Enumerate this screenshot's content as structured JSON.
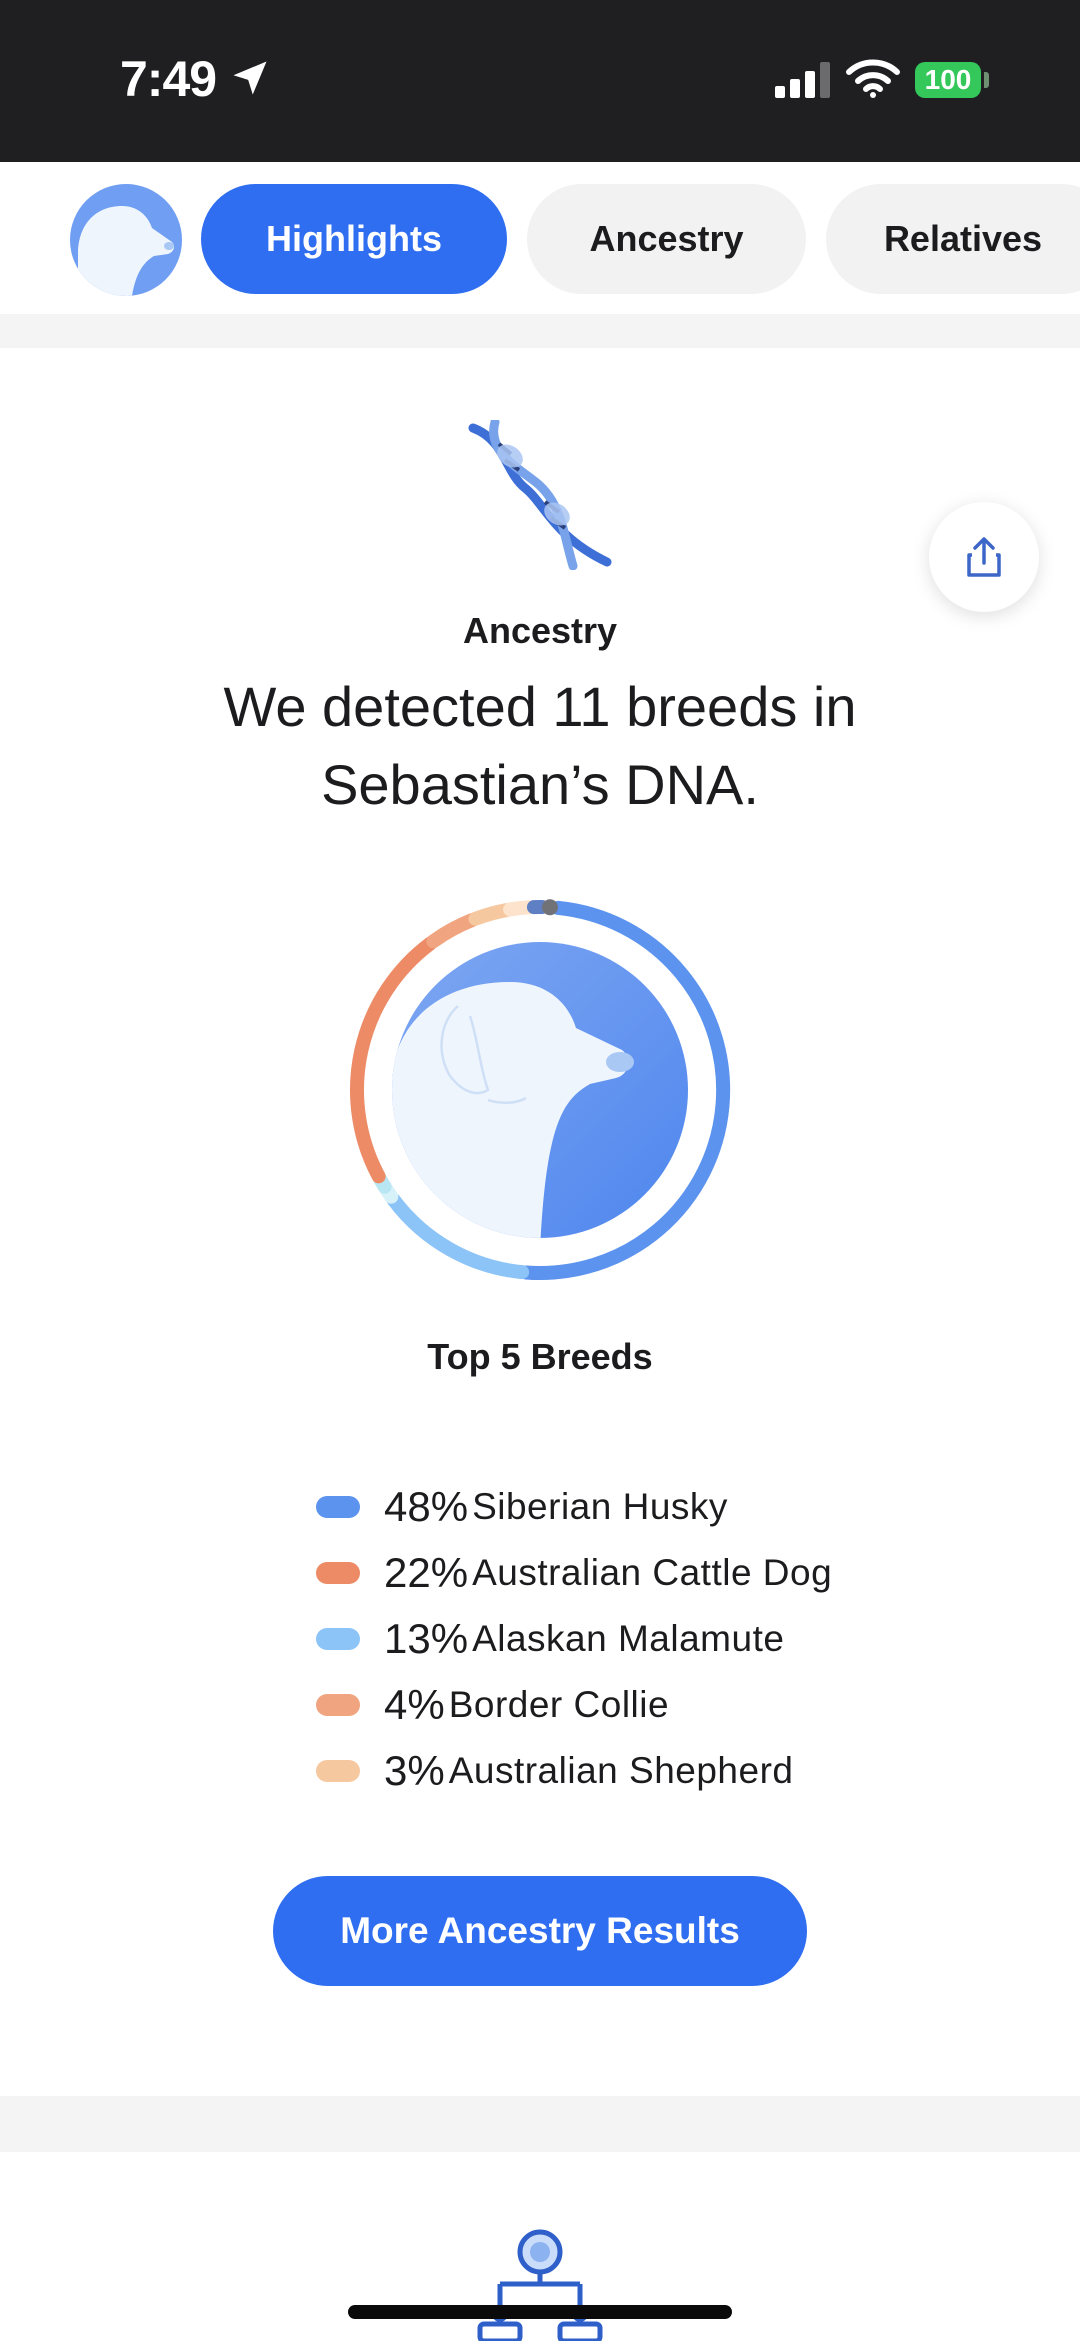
{
  "status_bar": {
    "time": "7:49",
    "battery": "100",
    "icons": [
      "location-arrow-icon",
      "cellular-signal-icon",
      "wifi-icon",
      "battery-icon"
    ]
  },
  "tabs": [
    {
      "label": "Highlights",
      "active": true
    },
    {
      "label": "Ancestry",
      "active": false
    },
    {
      "label": "Relatives",
      "active": false
    }
  ],
  "ancestry": {
    "section_label": "Ancestry",
    "headline": "We detected 11 breeds in Sebastian’s DNA.",
    "chart_title": "Top 5 Breeds",
    "cta_label": "More Ancestry Results"
  },
  "chart_data": {
    "type": "pie",
    "variant": "donut",
    "title": "Top 5 Breeds",
    "total_breeds": 11,
    "series": [
      {
        "name": "Siberian Husky",
        "percent": 48,
        "label": "48%",
        "color": "#5b93ee"
      },
      {
        "name": "Australian Cattle Dog",
        "percent": 22,
        "label": "22%",
        "color": "#ec8b66"
      },
      {
        "name": "Alaskan Malamute",
        "percent": 13,
        "label": "13%",
        "color": "#8cc4f7"
      },
      {
        "name": "Border Collie",
        "percent": 4,
        "label": "4%",
        "color": "#f0a47f"
      },
      {
        "name": "Australian Shepherd",
        "percent": 3,
        "label": "3%",
        "color": "#f6c8a0"
      }
    ],
    "other_segments": [
      {
        "percent": 1,
        "color": "#d7f1f8"
      },
      {
        "percent": 1,
        "color": "#b8e6f3"
      },
      {
        "percent": 2,
        "color": "#fde3cc"
      },
      {
        "percent": 1,
        "color": "#5e7fc4"
      },
      {
        "percent": 1,
        "color": "#717277"
      }
    ]
  },
  "colors": {
    "accent": "#2f6ef0",
    "status_bar_bg": "#1f1f21",
    "battery": "#34c759",
    "tab_inactive_bg": "#f2f2f3"
  }
}
